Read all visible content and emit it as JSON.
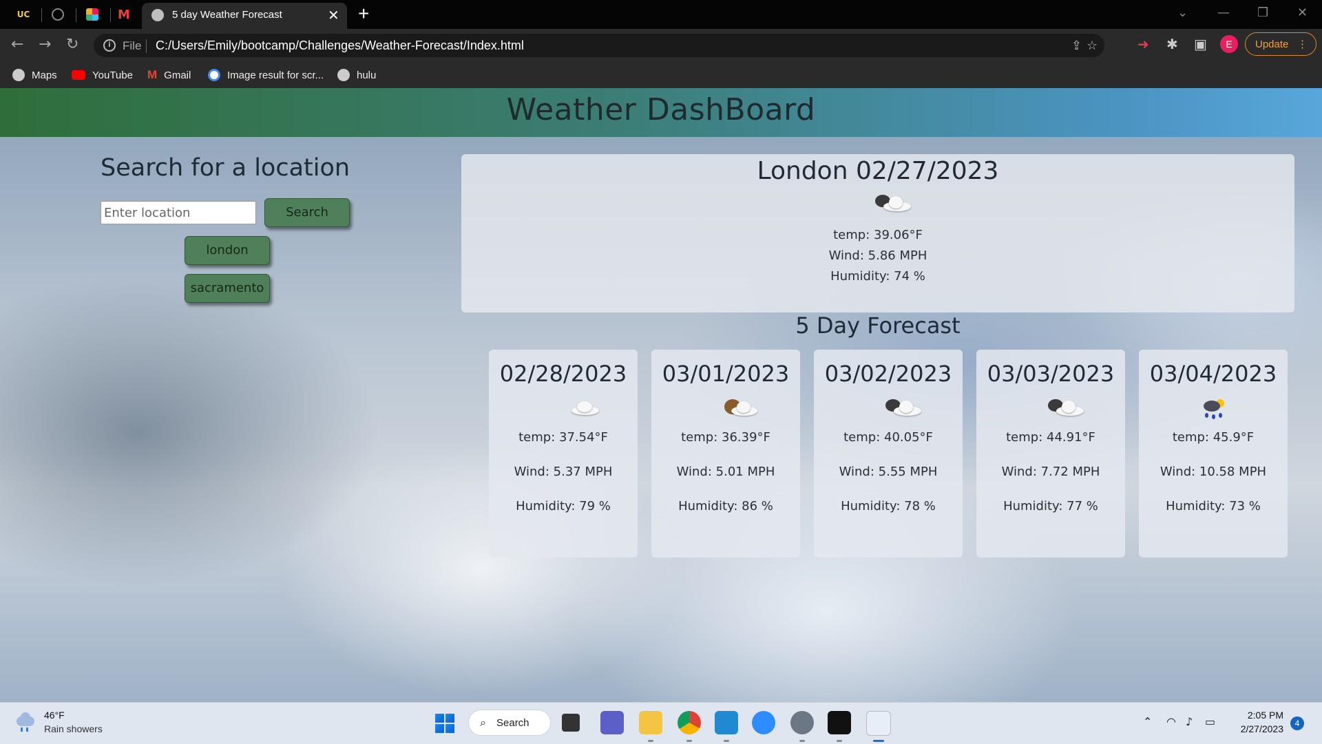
{
  "browser": {
    "pinned_tabs": [
      {
        "name": "ucdavis-tab",
        "label": "UC"
      },
      {
        "name": "github-tab",
        "label": ""
      },
      {
        "name": "slack-tab",
        "label": ""
      },
      {
        "name": "gmail-tab",
        "label": "M"
      }
    ],
    "active_tab_title": "5 day Weather Forecast",
    "address_prefix": "File",
    "url": "C:/Users/Emily/bootcamp/Challenges/Weather-Forecast/Index.html",
    "profile_initial": "E",
    "update_label": "Update",
    "bookmarks": [
      {
        "label": "Maps",
        "icon": "globe-icon"
      },
      {
        "label": "YouTube",
        "icon": "youtube-icon"
      },
      {
        "label": "Gmail",
        "icon": "gmail-icon"
      },
      {
        "label": "Image result for scr...",
        "icon": "google-icon"
      },
      {
        "label": "hulu",
        "icon": "globe-icon"
      }
    ]
  },
  "page": {
    "header_title": "Weather DashBoard",
    "search_heading": "Search for a location",
    "search_placeholder": "Enter location",
    "search_value": "",
    "search_button": "Search",
    "history": [
      "london",
      "sacramento"
    ],
    "current": {
      "title": "London 02/27/2023",
      "icon": "broken-clouds-icon",
      "temp": "temp: 39.06°F",
      "wind": "Wind: 5.86 MPH",
      "humidity": "Humidity: 74 %"
    },
    "forecast_heading": "5 Day Forecast",
    "forecast": [
      {
        "date": "02/28/2023",
        "icon": "few-clouds-icon",
        "temp": "temp: 37.54°F",
        "wind": "Wind: 5.37 MPH",
        "humidity": "Humidity: 79 %"
      },
      {
        "date": "03/01/2023",
        "icon": "partly-cloudy-icon",
        "temp": "temp: 36.39°F",
        "wind": "Wind: 5.01 MPH",
        "humidity": "Humidity: 86 %"
      },
      {
        "date": "03/02/2023",
        "icon": "broken-clouds-icon",
        "temp": "temp: 40.05°F",
        "wind": "Wind: 5.55 MPH",
        "humidity": "Humidity: 78 %"
      },
      {
        "date": "03/03/2023",
        "icon": "broken-clouds-icon",
        "temp": "temp: 44.91°F",
        "wind": "Wind: 7.72 MPH",
        "humidity": "Humidity: 77 %"
      },
      {
        "date": "03/04/2023",
        "icon": "rain-sun-icon",
        "temp": "temp: 45.9°F",
        "wind": "Wind: 10.58 MPH",
        "humidity": "Humidity: 73 %"
      }
    ]
  },
  "taskbar": {
    "weather_temp": "46°F",
    "weather_desc": "Rain showers",
    "search_label": "Search",
    "time": "2:05 PM",
    "date": "2/27/2023",
    "notification_count": "4"
  },
  "colors": {
    "header_gradient_start": "#2f6e3a",
    "header_gradient_end": "#58a6db",
    "button_green": "#4f8059",
    "update_orange": "#e08a1e"
  }
}
